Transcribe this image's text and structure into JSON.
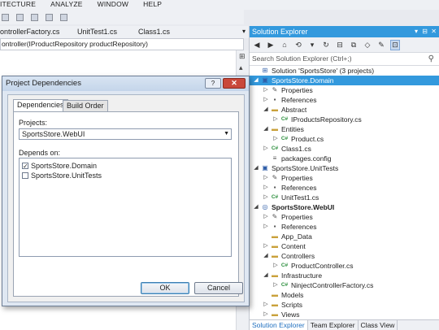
{
  "menu": [
    "ITECTURE",
    "ANALYZE",
    "WINDOW",
    "HELP"
  ],
  "editor": {
    "tabs": [
      "ontrollerFactory.cs",
      "UnitTest1.cs",
      "Class1.cs"
    ],
    "navbar": "ontroller(IProductRepository productRepository)"
  },
  "solution_explorer": {
    "title": "Solution Explorer",
    "title_controls": [
      "▾",
      "⊟",
      "✕"
    ],
    "search_placeholder": "Search Solution Explorer (Ctrl+;)",
    "tree": [
      {
        "level": 0,
        "arrow": "",
        "icon": "solution-icon",
        "label": "Solution 'SportsStore' (3 projects)",
        "selected": false
      },
      {
        "level": 0,
        "arrow": "◢",
        "icon": "project-icon",
        "label": "SportsStore.Domain",
        "selected": true
      },
      {
        "level": 1,
        "arrow": "▷",
        "icon": "wrench-icon",
        "label": "Properties",
        "selected": false
      },
      {
        "level": 1,
        "arrow": "▷",
        "icon": "references-icon",
        "label": "References",
        "selected": false
      },
      {
        "level": 1,
        "arrow": "◢",
        "icon": "folder-icon",
        "label": "Abstract",
        "selected": false
      },
      {
        "level": 2,
        "arrow": "▷",
        "icon": "csharp-file-icon",
        "label": "IProductsRepository.cs",
        "selected": false
      },
      {
        "level": 1,
        "arrow": "◢",
        "icon": "folder-icon",
        "label": "Entities",
        "selected": false
      },
      {
        "level": 2,
        "arrow": "▷",
        "icon": "csharp-file-icon",
        "label": "Product.cs",
        "selected": false
      },
      {
        "level": 1,
        "arrow": "▷",
        "icon": "csharp-file-icon",
        "label": "Class1.cs",
        "selected": false
      },
      {
        "level": 1,
        "arrow": "",
        "icon": "config-file-icon",
        "label": "packages.config",
        "selected": false
      },
      {
        "level": 0,
        "arrow": "◢",
        "icon": "project-icon",
        "label": "SportsStore.UnitTests",
        "selected": false
      },
      {
        "level": 1,
        "arrow": "▷",
        "icon": "wrench-icon",
        "label": "Properties",
        "selected": false
      },
      {
        "level": 1,
        "arrow": "▷",
        "icon": "references-icon",
        "label": "References",
        "selected": false
      },
      {
        "level": 1,
        "arrow": "▷",
        "icon": "csharp-file-icon",
        "label": "UnitTest1.cs",
        "selected": false
      },
      {
        "level": 0,
        "arrow": "◢",
        "icon": "web-project-icon",
        "label": "SportsStore.WebUI",
        "selected": false,
        "bold": true
      },
      {
        "level": 1,
        "arrow": "▷",
        "icon": "wrench-icon",
        "label": "Properties",
        "selected": false
      },
      {
        "level": 1,
        "arrow": "▷",
        "icon": "references-icon",
        "label": "References",
        "selected": false
      },
      {
        "level": 1,
        "arrow": "",
        "icon": "folder-icon",
        "label": "App_Data",
        "selected": false
      },
      {
        "level": 1,
        "arrow": "▷",
        "icon": "folder-icon",
        "label": "Content",
        "selected": false
      },
      {
        "level": 1,
        "arrow": "◢",
        "icon": "folder-icon",
        "label": "Controllers",
        "selected": false
      },
      {
        "level": 2,
        "arrow": "▷",
        "icon": "csharp-file-icon",
        "label": "ProductController.cs",
        "selected": false
      },
      {
        "level": 1,
        "arrow": "◢",
        "icon": "folder-icon",
        "label": "Infrastructure",
        "selected": false
      },
      {
        "level": 2,
        "arrow": "▷",
        "icon": "csharp-file-icon",
        "label": "NinjectControllerFactory.cs",
        "selected": false
      },
      {
        "level": 1,
        "arrow": "",
        "icon": "folder-icon",
        "label": "Models",
        "selected": false
      },
      {
        "level": 1,
        "arrow": "▷",
        "icon": "folder-icon",
        "label": "Scripts",
        "selected": false
      },
      {
        "level": 1,
        "arrow": "▷",
        "icon": "folder-icon",
        "label": "Views",
        "selected": false
      }
    ],
    "bottom_tabs": [
      "Solution Explorer",
      "Team Explorer",
      "Class View"
    ]
  },
  "dialog": {
    "title": "Project Dependencies",
    "help": "?",
    "close": "✕",
    "tabs": [
      "Dependencies",
      "Build Order"
    ],
    "projects_label": "Projects:",
    "selected_project": "SportsStore.WebUI",
    "depends_label": "Depends on:",
    "dependencies": [
      {
        "name": "SportsStore.Domain",
        "checked": true
      },
      {
        "name": "SportsStore.UnitTests",
        "checked": false
      }
    ],
    "ok": "OK",
    "cancel": "Cancel"
  }
}
